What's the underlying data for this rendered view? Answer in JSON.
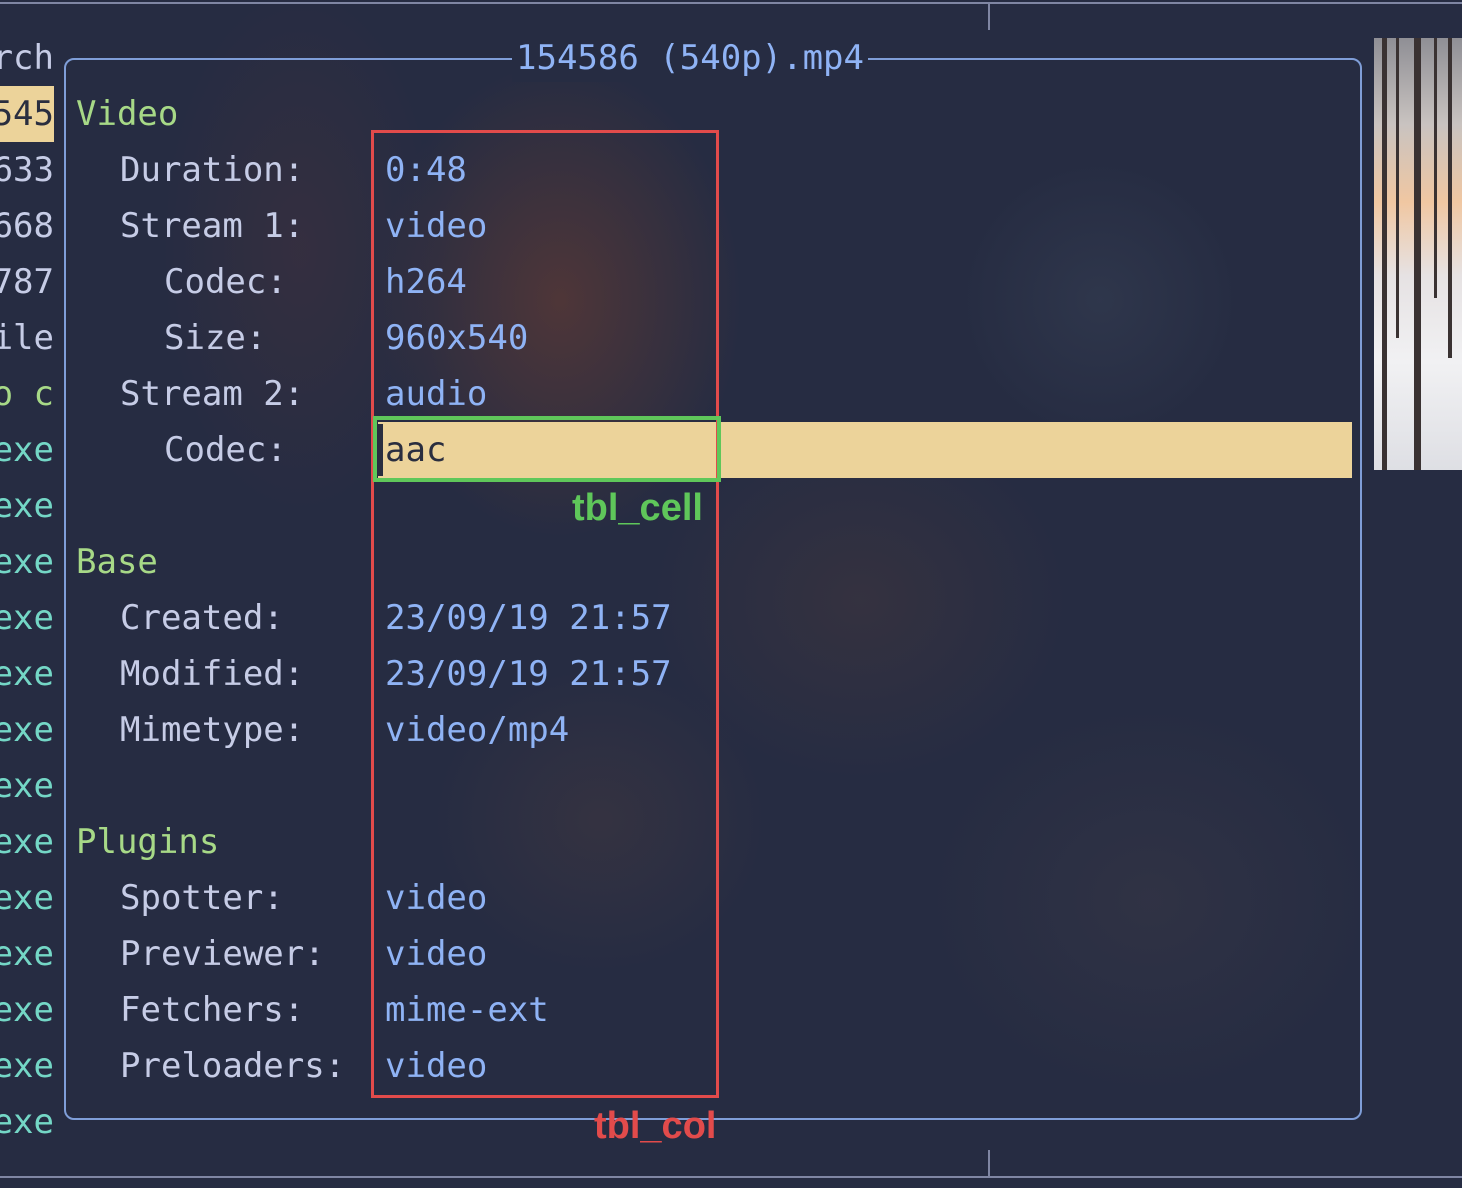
{
  "left_list": [
    {
      "text": "rch",
      "style": "plain"
    },
    {
      "text": "545",
      "style": "hl"
    },
    {
      "text": "633",
      "style": "plain"
    },
    {
      "text": "668",
      "style": "plain"
    },
    {
      "text": "787",
      "style": "plain"
    },
    {
      "text": "ile",
      "style": "plain"
    },
    {
      "text": "o c",
      "style": "green"
    },
    {
      "text": "exe",
      "style": "normal"
    },
    {
      "text": "exe",
      "style": "normal"
    },
    {
      "text": "exe",
      "style": "normal"
    },
    {
      "text": "exe",
      "style": "normal"
    },
    {
      "text": "exe",
      "style": "normal"
    },
    {
      "text": "exe",
      "style": "normal"
    },
    {
      "text": "exe",
      "style": "normal"
    },
    {
      "text": "exe",
      "style": "normal"
    },
    {
      "text": "exe",
      "style": "normal"
    },
    {
      "text": "exe",
      "style": "normal"
    },
    {
      "text": "exe",
      "style": "normal"
    },
    {
      "text": "exe",
      "style": "normal"
    },
    {
      "text": "exe",
      "style": "normal"
    }
  ],
  "popup": {
    "title": "154586 (540p).mp4",
    "sections": [
      {
        "name": "Video",
        "rows": [
          {
            "label": "Duration:",
            "value": "0:48",
            "indent": 1
          },
          {
            "label": "Stream 1:",
            "value": "video",
            "indent": 1
          },
          {
            "label": "Codec:",
            "value": "h264",
            "indent": 2
          },
          {
            "label": "Size:",
            "value": "960x540",
            "indent": 2
          },
          {
            "label": "Stream 2:",
            "value": "audio",
            "indent": 1
          },
          {
            "label": "Codec:",
            "value": "aac",
            "indent": 2,
            "selected": true
          }
        ]
      },
      {
        "name": "Base",
        "rows": [
          {
            "label": "Created:",
            "value": "23/09/19 21:57",
            "indent": 1
          },
          {
            "label": "Modified:",
            "value": "23/09/19 21:57",
            "indent": 1
          },
          {
            "label": "Mimetype:",
            "value": "video/mp4",
            "indent": 1
          }
        ]
      },
      {
        "name": "Plugins",
        "rows": [
          {
            "label": "Spotter:",
            "value": "video",
            "indent": 1
          },
          {
            "label": "Previewer:",
            "value": "video",
            "indent": 1
          },
          {
            "label": "Fetchers:",
            "value": "mime-ext",
            "indent": 1
          },
          {
            "label": "Preloaders:",
            "value": "video",
            "indent": 1
          }
        ]
      }
    ]
  },
  "annotations": {
    "cell_label": "tbl_cell",
    "column_label": "tbl_col",
    "cell_color": "#5fc75a",
    "column_color": "#e24b4b"
  },
  "colors": {
    "background": "#262c42",
    "section": "#a7d987",
    "label": "#c6cce6",
    "value": "#8fb3f5",
    "highlight": "#ecd39a",
    "border": "#7f9ed8"
  }
}
